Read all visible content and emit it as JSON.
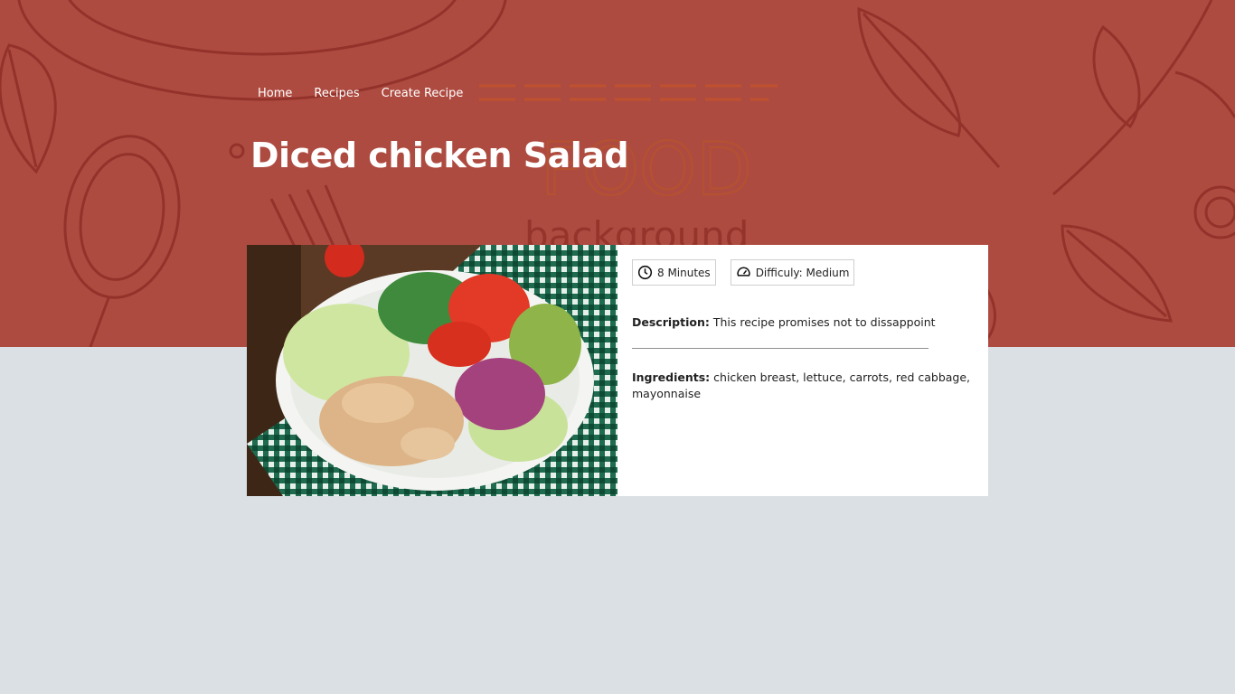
{
  "nav": {
    "items": [
      {
        "label": "Home"
      },
      {
        "label": "Recipes"
      },
      {
        "label": "Create Recipe"
      }
    ]
  },
  "recipe": {
    "title": "Diced chicken Salad",
    "time": "8 Minutes",
    "difficulty": "Difficuly: Medium",
    "description_label": "Description:",
    "description": "This recipe promises not to dissappoint",
    "ingredients_label": "Ingredients:",
    "ingredients": "chicken breast, lettuce, carrots, red cabbage, mayonnaise"
  },
  "hero_background": {
    "word1": "FOOD",
    "word2": "background"
  },
  "colors": {
    "hero": "#ae4b41",
    "page": "#dae0e3",
    "card": "#ffffff"
  },
  "icons": {
    "time": "clock-icon",
    "difficulty": "gauge-icon"
  }
}
